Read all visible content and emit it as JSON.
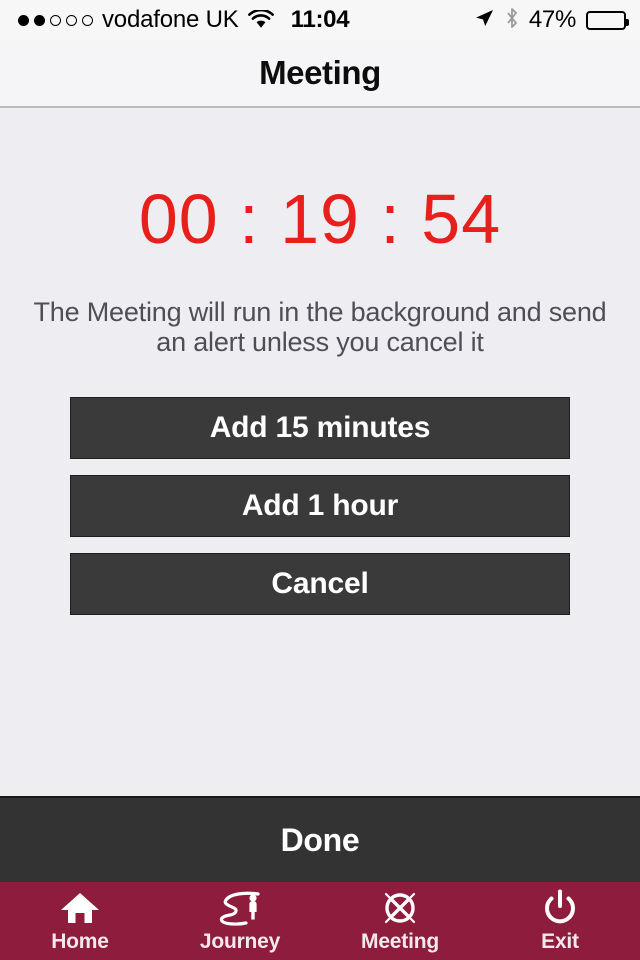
{
  "status_bar": {
    "signal_dots": [
      "filled",
      "filled",
      "empty",
      "empty",
      "empty"
    ],
    "carrier": "vodafone UK",
    "wifi_icon": "wifi-icon",
    "time": "11:04",
    "location_icon": "location-arrow-icon",
    "bluetooth_icon": "bluetooth-icon",
    "battery_percent": "47%",
    "battery_level": 47,
    "battery_icon": "battery-icon"
  },
  "navbar": {
    "title": "Meeting"
  },
  "main": {
    "timer": "00 : 19 : 54",
    "timer_color": "#e8201c",
    "description": "The Meeting will run in the background and send an alert unless you cancel it",
    "buttons": [
      {
        "label": "Add 15 minutes",
        "name": "add-15-minutes-button"
      },
      {
        "label": "Add 1 hour",
        "name": "add-1-hour-button"
      },
      {
        "label": "Cancel",
        "name": "cancel-button"
      }
    ]
  },
  "done_bar": {
    "label": "Done"
  },
  "tabbar": {
    "background": "#8e1c3c",
    "items": [
      {
        "label": "Home",
        "icon": "home-icon"
      },
      {
        "label": "Journey",
        "icon": "journey-road-person-icon"
      },
      {
        "label": "Meeting",
        "icon": "crossed-circle-icon"
      },
      {
        "label": "Exit",
        "icon": "power-icon"
      }
    ]
  }
}
